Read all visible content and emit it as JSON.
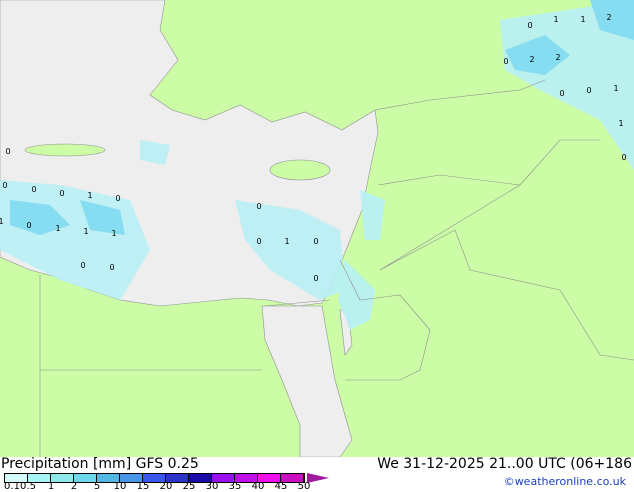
{
  "title": "Precipitation [mm]  GFS 0.25",
  "valid_time": "We 31-12-2025 21..00 UTC (06+186",
  "credit": "©weatheronline.co.uk",
  "colors": {
    "land": "#ccfca6",
    "sea": "#eeeeee",
    "border": "#909090"
  },
  "legend": {
    "ticks": [
      "0.1",
      "0.5",
      "1",
      "2",
      "5",
      "10",
      "15",
      "20",
      "25",
      "30",
      "35",
      "40",
      "45",
      "50"
    ],
    "colors": [
      "#d4fafa",
      "#a6f5f5",
      "#8ce8ea",
      "#6cd8ec",
      "#52b8e6",
      "#4896e8",
      "#3a56ee",
      "#2a34c8",
      "#1a0aa8",
      "#9a10ee",
      "#c010e8",
      "#ee10ee",
      "#c810c0"
    ]
  },
  "map_labels": [
    "0",
    "1",
    "1",
    "2",
    "0",
    "2",
    "2",
    "0",
    "0",
    "1",
    "1",
    "0",
    "0",
    "0",
    "0",
    "0",
    "1",
    "0",
    "1",
    "0",
    "1",
    "1",
    "1",
    "0",
    "0",
    "0",
    "0",
    "1",
    "0",
    "0"
  ]
}
